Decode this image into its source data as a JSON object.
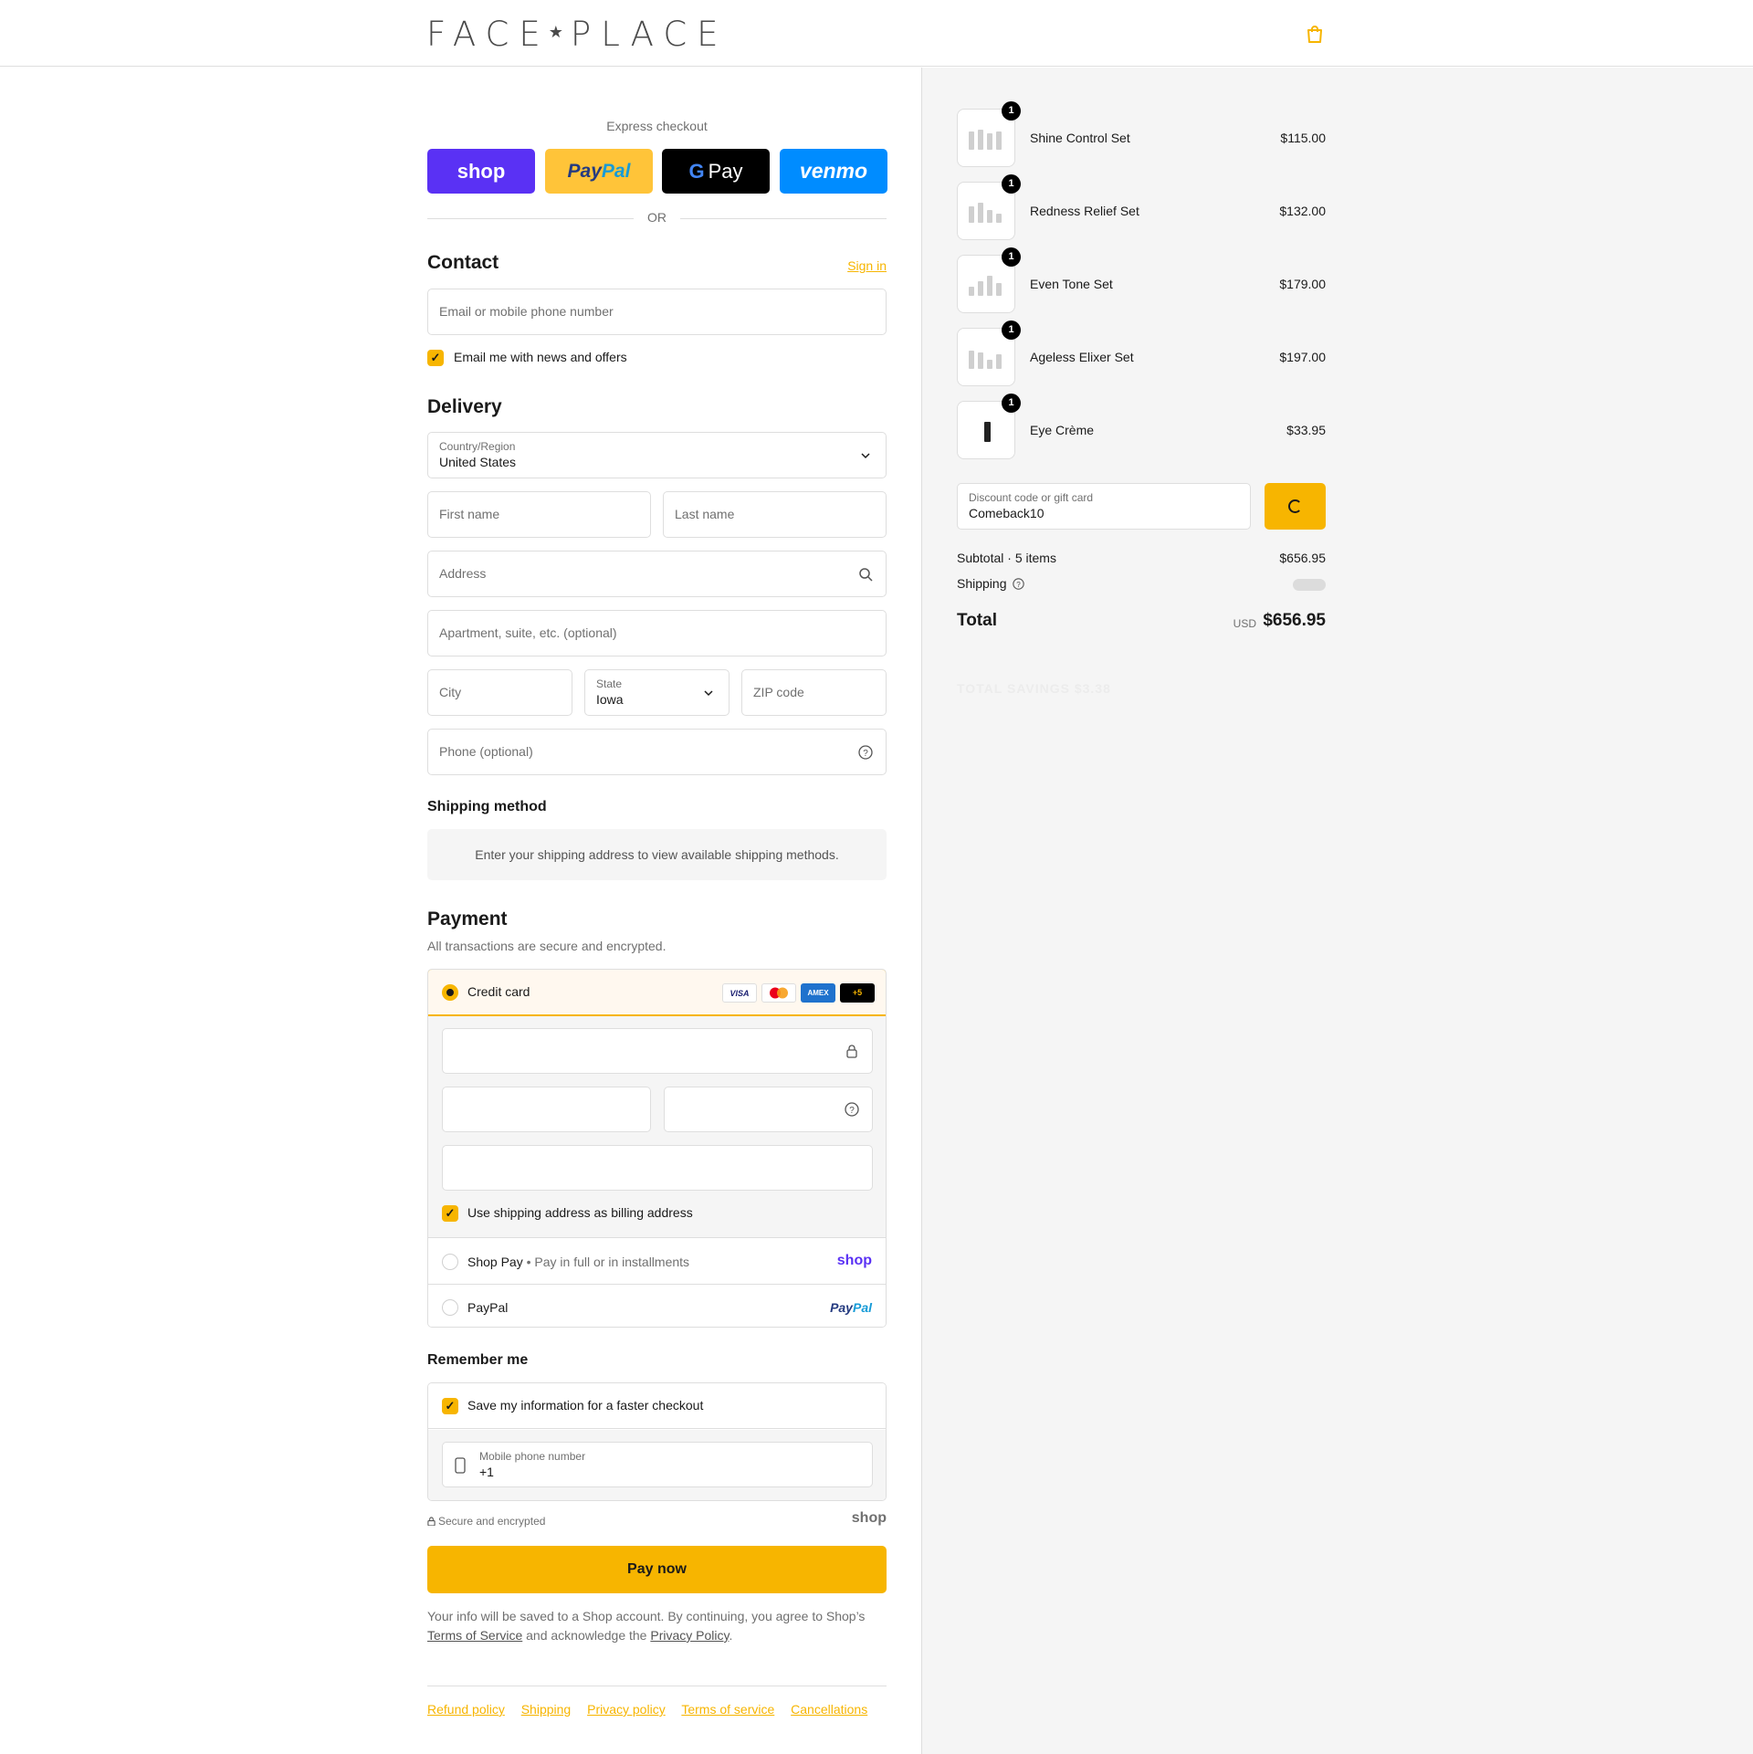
{
  "header": {
    "logo_left": "FACE",
    "logo_star": "★",
    "logo_right": "PLACE",
    "bag_icon": "shopping-bag-icon"
  },
  "express": {
    "title": "Express checkout",
    "shop": "shop",
    "paypal_a": "Pay",
    "paypal_b": "Pal",
    "gpay_g": "G",
    "gpay": "Pay",
    "venmo": "venmo",
    "or": "OR"
  },
  "contact": {
    "title": "Contact",
    "signin": "Sign in",
    "email_placeholder": "Email or mobile phone number",
    "news_label": "Email me with news and offers",
    "news_checked": true
  },
  "delivery": {
    "title": "Delivery",
    "country_label": "Country/Region",
    "country_value": "United States",
    "first_name": "First name",
    "last_name": "Last name",
    "address": "Address",
    "apartment": "Apartment, suite, etc. (optional)",
    "city": "City",
    "state_label": "State",
    "state_value": "Iowa",
    "zip": "ZIP code",
    "phone": "Phone (optional)"
  },
  "shipping_method": {
    "title": "Shipping method",
    "note": "Enter your shipping address to view available shipping methods."
  },
  "payment": {
    "title": "Payment",
    "subtitle": "All transactions are secure and encrypted.",
    "credit_card": "Credit card",
    "cards": [
      "VISA",
      "MC",
      "AMEX",
      "+5"
    ],
    "billing_label": "Use shipping address as billing address",
    "shop_pay": "Shop Pay",
    "shop_pay_sub": "Pay in full or in installments",
    "shop_pay_brand": "shop",
    "paypal": "PayPal",
    "paypal_brand_a": "Pay",
    "paypal_brand_b": "Pal"
  },
  "remember": {
    "title": "Remember me",
    "save_label": "Save my information for a faster checkout",
    "phone_label": "Mobile phone number",
    "phone_value": "+1"
  },
  "secure": {
    "text": "Secure and encrypted",
    "brand": "shop"
  },
  "pay_now": "Pay now",
  "legal": {
    "text1": "Your info will be saved to a Shop account. By continuing, you agree to Shop’s",
    "tos": "Terms of Service",
    "text2": "and acknowledge the",
    "privacy": "Privacy Policy",
    "dot": "."
  },
  "footer": [
    "Refund policy",
    "Shipping",
    "Privacy policy",
    "Terms of service",
    "Cancellations"
  ],
  "summary": {
    "items": [
      {
        "name": "Shine Control Set",
        "price": "$115.00",
        "qty": "1"
      },
      {
        "name": "Redness Relief Set",
        "price": "$132.00",
        "qty": "1"
      },
      {
        "name": "Even Tone Set",
        "price": "$179.00",
        "qty": "1"
      },
      {
        "name": "Ageless Elixer Set",
        "price": "$197.00",
        "qty": "1"
      },
      {
        "name": "Eye Crème",
        "price": "$33.95",
        "qty": "1"
      }
    ],
    "discount_label": "Discount code or gift card",
    "discount_value": "Comeback10",
    "subtotal_label": "Subtotal · 5 items",
    "subtotal": "$656.95",
    "shipping_label": "Shipping",
    "total_label": "Total",
    "currency": "USD",
    "total": "$656.95",
    "savings": "TOTAL SAVINGS $3.38"
  },
  "colors": {
    "accent": "#f7b500",
    "shop_purple": "#5a31f4",
    "paypal_yellow": "#ffc439",
    "venmo_blue": "#008cff"
  }
}
